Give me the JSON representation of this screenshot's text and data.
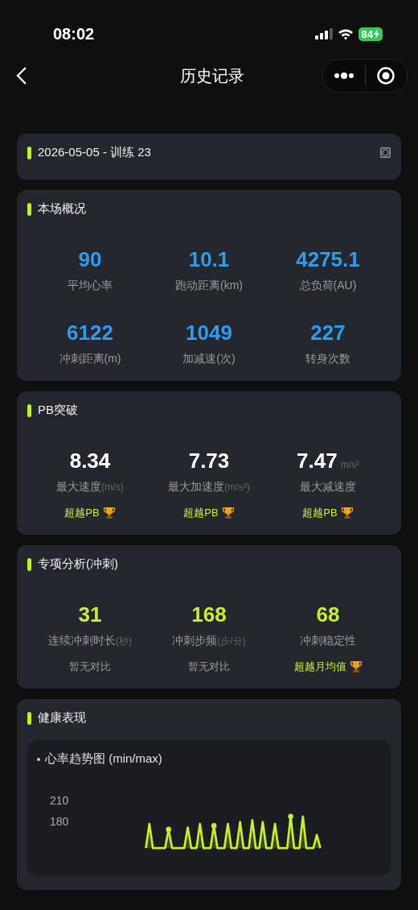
{
  "status_bar": {
    "time": "08:02",
    "battery": "84"
  },
  "nav": {
    "title": "历史记录"
  },
  "session": {
    "title": "2026-05-05 - 训练 23"
  },
  "sections": [
    {
      "title": "本场概况",
      "color": "#2f9bea",
      "items": [
        {
          "value": "90",
          "label": "平均心率"
        },
        {
          "value": "10.1",
          "label": "跑动距离(km)"
        },
        {
          "value": "4275.1",
          "label": "总负荷(AU)"
        },
        {
          "value": "6122",
          "label": "冲刺距离(m)"
        },
        {
          "value": "1049",
          "label": "加减速(次)"
        },
        {
          "value": "227",
          "label": "转身次数"
        }
      ]
    },
    {
      "title": "PB突破",
      "color": "#ffffff",
      "items": [
        {
          "value": "8.34",
          "label": "最大速度",
          "label_unit": "(m/s)",
          "note": "超越PB",
          "highlight": true,
          "trophy": true
        },
        {
          "value": "7.73",
          "label": "最大加速度",
          "label_unit": "(m/s²)",
          "note": "超越PB",
          "highlight": true,
          "trophy": true
        },
        {
          "value": "7.47",
          "value_unit": "m/s²",
          "label": "最大减速度",
          "note": "超越PB",
          "highlight": true,
          "trophy": true
        }
      ]
    },
    {
      "title": "专项分析(冲刺)",
      "color": "#c6f02a",
      "items": [
        {
          "value": "31",
          "label": "连续冲刺时长",
          "label_unit": "(秒)",
          "note": "暂无对比",
          "highlight": false,
          "trophy": false
        },
        {
          "value": "168",
          "label": "冲刺步频",
          "label_unit": "(步/分)",
          "note": "暂无对比",
          "highlight": false,
          "trophy": false
        },
        {
          "value": "68",
          "label": "冲刺稳定性",
          "note": "超越月均值",
          "highlight": true,
          "trophy": true
        }
      ]
    }
  ],
  "health": {
    "title": "健康表现",
    "chart_title": "心率趋势图 (min/max)",
    "y_labels": [
      "210",
      "180"
    ]
  }
}
